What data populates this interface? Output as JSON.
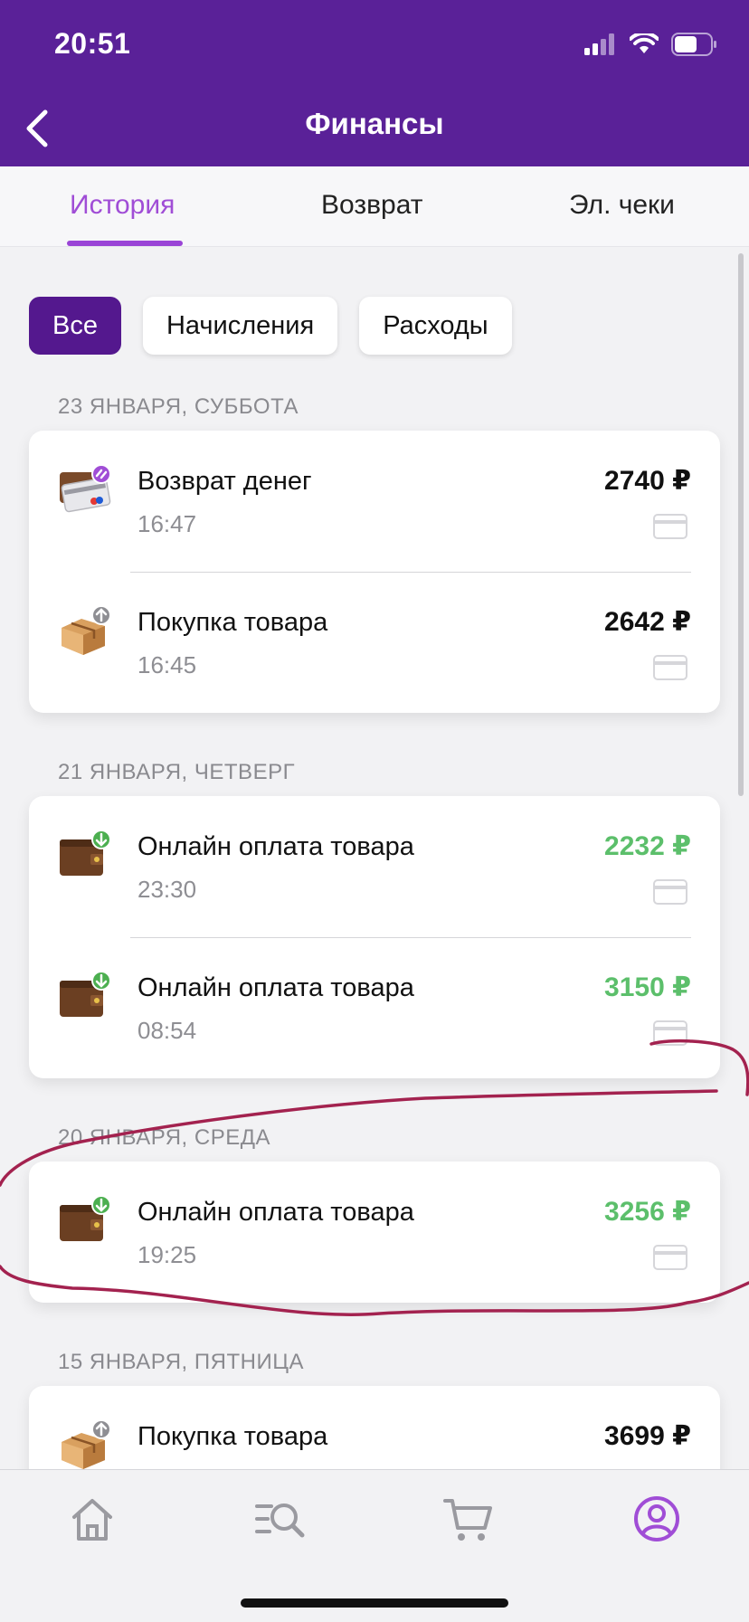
{
  "status": {
    "time": "20:51"
  },
  "header": {
    "title": "Финансы"
  },
  "tabs": [
    {
      "label": "История"
    },
    {
      "label": "Возврат"
    },
    {
      "label": "Эл. чеки"
    }
  ],
  "active_tab": "История",
  "filters": [
    {
      "label": "Все"
    },
    {
      "label": "Начисления"
    },
    {
      "label": "Расходы"
    }
  ],
  "active_filter": "Все",
  "groups": [
    {
      "date": "23 ЯНВАРЯ, СУББОТА",
      "items": [
        {
          "title": "Возврат денег",
          "time": "16:47",
          "amount": "2740 ₽",
          "icon": "refund-card-icon"
        },
        {
          "title": "Покупка товара",
          "time": "16:45",
          "amount": "2642 ₽",
          "icon": "parcel-box-icon"
        }
      ]
    },
    {
      "date": "21 ЯНВАРЯ, ЧЕТВЕРГ",
      "items": [
        {
          "title": "Онлайн оплата товара",
          "time": "23:30",
          "amount": "2232 ₽",
          "icon": "wallet-icon"
        },
        {
          "title": "Онлайн оплата товара",
          "time": "08:54",
          "amount": "3150 ₽",
          "icon": "wallet-icon"
        }
      ]
    },
    {
      "date": "20 ЯНВАРЯ, СРЕДА",
      "items": [
        {
          "title": "Онлайн оплата товара",
          "time": "19:25",
          "amount": "3256 ₽",
          "icon": "wallet-icon"
        }
      ]
    },
    {
      "date": "15 ЯНВАРЯ, ПЯТНИЦА",
      "items": [
        {
          "title": "Покупка товара",
          "time": "",
          "amount": "3699 ₽",
          "icon": "parcel-box-icon"
        }
      ]
    }
  ],
  "tabbar": [
    {
      "icon": "home-icon"
    },
    {
      "icon": "catalog-search-icon"
    },
    {
      "icon": "cart-icon"
    },
    {
      "icon": "profile-icon"
    }
  ],
  "colors": {
    "header_bg": "#5a2198",
    "accent": "#9a44d6",
    "chip_active": "#54188e",
    "income_green": "#5cbf6b",
    "annotation": "#a3224f"
  }
}
